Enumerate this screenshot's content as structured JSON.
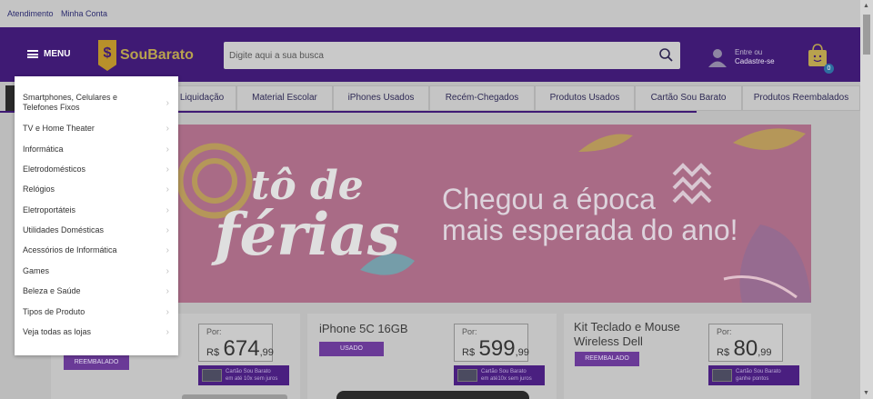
{
  "topbar": {
    "atendimento": "Atendimento",
    "minha_conta": "Minha Conta"
  },
  "header": {
    "menu_label": "MENU",
    "logo_text": "SouBarato",
    "search_placeholder": "Digite aqui a sua busca",
    "account_line1": "Entre ou",
    "account_line2": "Cadastre-se",
    "cart_count": "0"
  },
  "nav": [
    "Liquidação",
    "Material Escolar",
    "iPhones Usados",
    "Recém-Chegados",
    "Produtos Usados",
    "Cartão Sou Barato",
    "Produtos Reembalados"
  ],
  "dropdown": [
    "Smartphones, Celulares e Telefones Fixos",
    "TV e Home Theater",
    "Informática",
    "Eletrodomésticos",
    "Relógios",
    "Eletroportáteis",
    "Utilidades Domésticas",
    "Acessórios de Informática",
    "Games",
    "Beleza e Saúde",
    "Tipos de Produto",
    "Veja todas as lojas"
  ],
  "banner": {
    "script_line1": "tô de",
    "script_line2": "férias",
    "headline_line1": "Chegou a época",
    "headline_line2": "mais esperada do ano!"
  },
  "products": [
    {
      "title": "",
      "badge": "REEMBALADO",
      "por": "Por:",
      "currency": "R$",
      "price": "674",
      "cents": ",99",
      "promo_line1": "Cartão Sou Barato",
      "promo_line2": "em até 10x sem juros"
    },
    {
      "title": "iPhone 5C 16GB",
      "badge": "USADO",
      "por": "Por:",
      "currency": "R$",
      "price": "599",
      "cents": ",99",
      "promo_line1": "Cartão Sou Barato",
      "promo_line2": "em até10x sem juros"
    },
    {
      "title": "Kit Teclado e Mouse Wireless Dell",
      "badge": "REEMBALADO",
      "por": "Por:",
      "currency": "R$",
      "price": "80",
      "cents": ",99",
      "promo_line1": "Cartão Sou Barato",
      "promo_line2": "ganhe pontos"
    }
  ],
  "colors": {
    "brand_purple": "#3f1a74",
    "logo_gold": "#b8902a",
    "banner_pink": "#a96b86"
  }
}
